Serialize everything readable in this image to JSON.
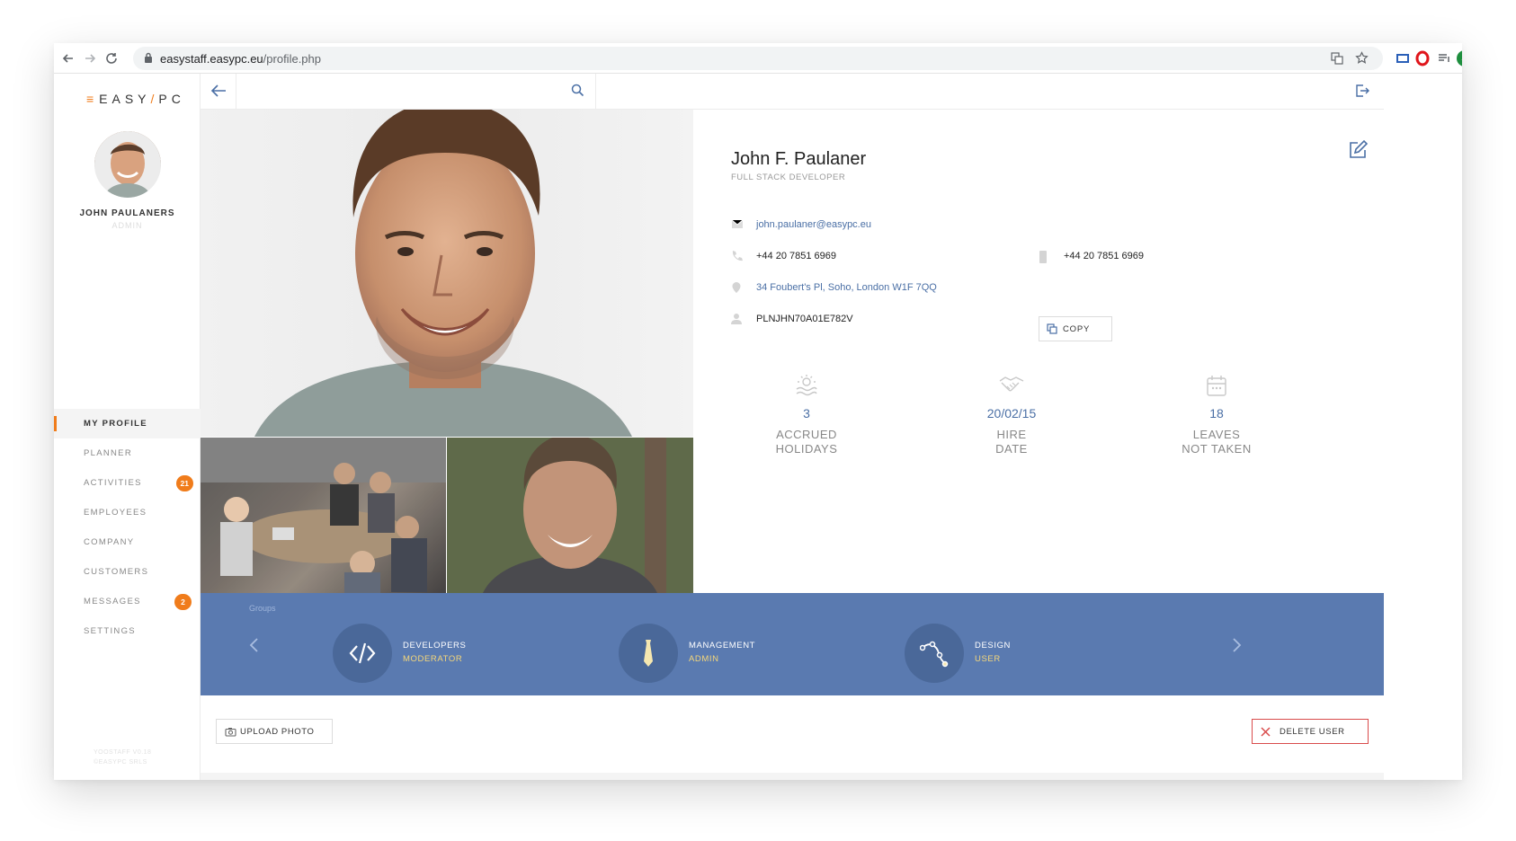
{
  "browser": {
    "url_host": "easystaff.easypc.eu",
    "url_path": "/profile.php"
  },
  "sidebar": {
    "logo": {
      "prefix": "EASY",
      "slash": "/",
      "suffix": "PC"
    },
    "user_name": "JOHN PAULANERS",
    "user_role": "ADMIN",
    "menu": [
      {
        "label": "MY PROFILE",
        "active": true,
        "badge": ""
      },
      {
        "label": "PLANNER",
        "active": false,
        "badge": ""
      },
      {
        "label": "ACTIVITIES",
        "active": false,
        "badge": "21"
      },
      {
        "label": "EMPLOYEES",
        "active": false,
        "badge": ""
      },
      {
        "label": "COMPANY",
        "active": false,
        "badge": ""
      },
      {
        "label": "CUSTOMERS",
        "active": false,
        "badge": ""
      },
      {
        "label": "MESSAGES",
        "active": false,
        "badge": "2"
      },
      {
        "label": "SETTINGS",
        "active": false,
        "badge": ""
      }
    ],
    "footer_line1": "YOOSTAFF V0.18",
    "footer_line2": "©EASYPC SRLS"
  },
  "topbar": {
    "search_placeholder": ""
  },
  "profile": {
    "name": "John F. Paulaner",
    "job_title": "FULL STACK DEVELOPER",
    "email": "john.paulaner@easypc.eu",
    "phone": "+44 20 7851 6969",
    "mobile": "+44 20 7851 6969",
    "address": "34 Foubert's Pl, Soho, London W1F 7QQ",
    "fiscal_code": "PLNJHN70A01E782V",
    "copy_label": "COPY",
    "stats": [
      {
        "value": "3",
        "label_line1": "ACCRUED",
        "label_line2": "HOLIDAYS",
        "icon": "beach-icon"
      },
      {
        "value": "20/02/15",
        "label_line1": "HIRE",
        "label_line2": "DATE",
        "icon": "handshake-icon"
      },
      {
        "value": "18",
        "label_line1": "LEAVES",
        "label_line2": "NOT TAKEN",
        "icon": "calendar-icon"
      }
    ]
  },
  "groups": {
    "label": "Groups",
    "items": [
      {
        "name": "DEVELOPERS",
        "role": "MODERATOR",
        "icon": "code-icon"
      },
      {
        "name": "MANAGEMENT",
        "role": "ADMIN",
        "icon": "tie-icon"
      },
      {
        "name": "DESIGN",
        "role": "USER",
        "icon": "bezier-icon"
      }
    ]
  },
  "footer": {
    "upload_label": "UPLOAD PHOTO",
    "delete_label": "DELETE USER"
  },
  "colors": {
    "accent": "#f07c1b",
    "link": "#4a6fa5",
    "groups_bg": "#5a7ab0",
    "danger": "#d94b4b"
  }
}
